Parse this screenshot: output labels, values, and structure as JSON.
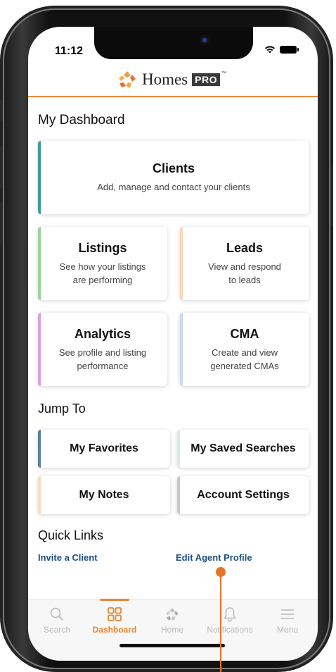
{
  "status_bar": {
    "time": "11:12"
  },
  "brand": {
    "name": "Homes",
    "badge": "PRO",
    "trademark": "™"
  },
  "dashboard": {
    "title": "My Dashboard",
    "clients": {
      "title": "Clients",
      "subtitle": "Add, manage and contact your clients",
      "accent": "#3f9a9a"
    },
    "listings": {
      "title": "Listings",
      "subtitle_1": "See how your listings",
      "subtitle_2": "are performing",
      "accent": "#9bd49a"
    },
    "leads": {
      "title": "Leads",
      "subtitle_1": "View and respond",
      "subtitle_2": "to leads",
      "accent": "#f9d8b8"
    },
    "analytics": {
      "title": "Analytics",
      "subtitle_1": "See profile and listing",
      "subtitle_2": "performance",
      "accent": "#d9a0e0"
    },
    "cma": {
      "title": "CMA",
      "subtitle_1": "Create and view",
      "subtitle_2": "generated CMAs",
      "accent": "#c9daf2"
    }
  },
  "jump_to": {
    "title": "Jump To",
    "favorites": {
      "label": "My Favorites",
      "accent": "#5a7fa6"
    },
    "saved_searches": {
      "label": "My Saved Searches",
      "accent": "#dde6f5"
    },
    "notes": {
      "label": "My Notes",
      "accent": "#f9dcc1"
    },
    "account_settings": {
      "label": "Account Settings",
      "accent": "#c8c8c8"
    }
  },
  "quick_links": {
    "title": "Quick Links",
    "invite": "Invite a Client",
    "edit_profile": "Edit Agent Profile"
  },
  "tabs": [
    {
      "label": "Search",
      "icon": "search-icon",
      "active": false
    },
    {
      "label": "Dashboard",
      "icon": "dashboard-grid-icon",
      "active": true
    },
    {
      "label": "Home",
      "icon": "homes-logo-icon",
      "active": false
    },
    {
      "label": "Notifications",
      "icon": "bell-icon",
      "active": false
    },
    {
      "label": "Menu",
      "icon": "menu-icon",
      "active": false
    }
  ],
  "colors": {
    "brand_orange": "#e9852e",
    "link_blue": "#1f4f82"
  }
}
